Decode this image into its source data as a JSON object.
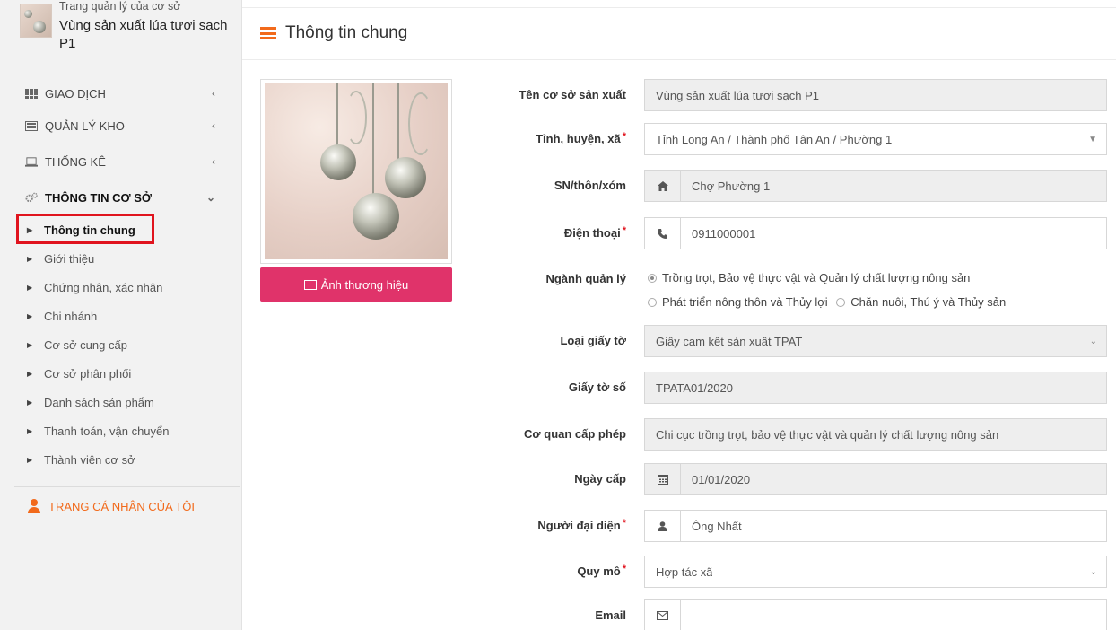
{
  "sidebar": {
    "brand": {
      "subtitle": "Trang quản lý của cơ sở",
      "name": "Vùng sản xuất lúa tươi sạch P1"
    },
    "menu": [
      {
        "label": "GIAO DỊCH",
        "icon": "grid-icon",
        "expanded": false
      },
      {
        "label": "QUẢN LÝ KHO",
        "icon": "inbox-icon",
        "expanded": false
      },
      {
        "label": "THỐNG KÊ",
        "icon": "laptop-icon",
        "expanded": false
      },
      {
        "label": "THÔNG TIN CƠ SỞ",
        "icon": "cogs-icon",
        "expanded": true
      }
    ],
    "submenu": [
      "Thông tin chung",
      "Giới thiệu",
      "Chứng nhận, xác nhận",
      "Chi nhánh",
      "Cơ sở cung cấp",
      "Cơ sở phân phối",
      "Danh sách sản phẩm",
      "Thanh toán, vận chuyển",
      "Thành viên cơ sở"
    ],
    "profile_label": "TRANG CÁ NHÂN CỦA TÔI"
  },
  "header": {
    "title": "Thông tin chung"
  },
  "brand_image": {
    "button_label": "Ảnh thương hiệu"
  },
  "form": {
    "ten_co_so": {
      "label": "Tên cơ sở sản xuất",
      "value": "Vùng sản xuất lúa tươi sạch P1"
    },
    "tinh": {
      "label": "Tỉnh, huyện, xã",
      "required": "*",
      "value": "Tỉnh Long An / Thành phố Tân An / Phường 1"
    },
    "thon_xom": {
      "label": "SN/thôn/xóm",
      "value": "Chợ Phường 1"
    },
    "dien_thoai": {
      "label": "Điện thoại",
      "required": "*",
      "value": "0911000001"
    },
    "nganh_quan_ly": {
      "label": "Ngành quản lý",
      "options": [
        "Trồng trọt, Bảo vệ thực vật và Quản lý chất lượng nông sản",
        "Phát triển nông thôn và Thủy lợi",
        "Chăn nuôi, Thú ý và Thủy sản"
      ],
      "selected_index": 0
    },
    "loai_giay_to": {
      "label": "Loại giấy tờ",
      "value": "Giấy cam kết sản xuất TPAT"
    },
    "giay_to_so": {
      "label": "Giấy tờ số",
      "value": "TPATA01/2020"
    },
    "co_quan": {
      "label": "Cơ quan cấp phép",
      "value": "Chi cục trồng trọt, bảo vệ thực vật và quản lý chất lượng nông sản"
    },
    "ngay_cap": {
      "label": "Ngày cấp",
      "value": "01/01/2020"
    },
    "nguoi_dai_dien": {
      "label": "Người đại diện",
      "required": "*",
      "value": "Ông Nhất"
    },
    "quy_mo": {
      "label": "Quy mô",
      "required": "*",
      "value": "Hợp tác xã"
    },
    "email": {
      "label": "Email",
      "value": ""
    }
  },
  "colors": {
    "accent": "#f26a1b",
    "button_pink": "#e0336a",
    "highlight_red": "#e0141e"
  }
}
